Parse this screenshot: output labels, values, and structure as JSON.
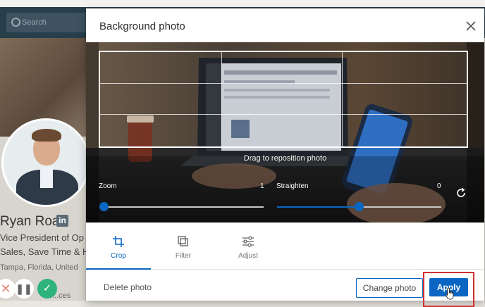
{
  "background_page": {
    "search": {
      "placeholder": "Search"
    },
    "profile": {
      "name": "Ryan Roa",
      "badge": "in",
      "headline_line1": "Vice President of Op",
      "headline_line2": "Sales, Save Time & H",
      "location": "Tampa, Florida, United",
      "services": "...ces"
    }
  },
  "modal": {
    "title": "Background photo",
    "drag_hint": "Drag to reposition photo",
    "zoom": {
      "label": "Zoom",
      "value": "1",
      "position_fraction": 0
    },
    "straighten": {
      "label": "Straighten",
      "value": "0",
      "position_fraction": 0.5
    },
    "tabs": [
      {
        "label": "Crop",
        "icon": "crop-icon",
        "active": true
      },
      {
        "label": "Filter",
        "icon": "filter-icon",
        "active": false
      },
      {
        "label": "Adjust",
        "icon": "adjust-sliders-icon",
        "active": false
      }
    ],
    "footer": {
      "delete_label": "Delete photo",
      "change_label": "Change photo",
      "apply_label": "Apply"
    }
  },
  "colors": {
    "accent": "#0a66c2",
    "highlight": "#d32f2f",
    "header": "#283e4a"
  }
}
